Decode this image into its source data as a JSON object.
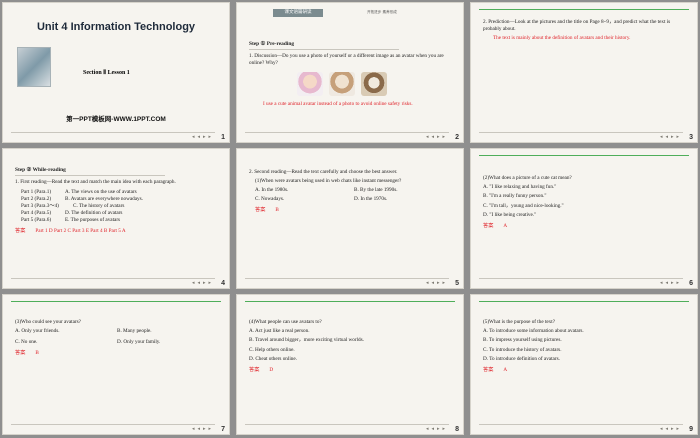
{
  "slides": [
    {
      "num": "1",
      "unit_title": "Unit 4   Information Technology",
      "section": "Section Ⅱ     Lesson 1",
      "brand": "第一PPT模板网-WWW.1PPT.COM"
    },
    {
      "num": "2",
      "header_tag": "课文语篇研读",
      "header_right": "开拓进步    素养形成",
      "step": "Step ①     Pre-reading",
      "question": "1.  Discussion—Do you use a photo of yourself or a different image as an avatar when you are online? Why?",
      "answer": "I use a cute animal avatar instead of a photo to avoid online safety risks."
    },
    {
      "num": "3",
      "prediction": "2.  Prediction—Look at the pictures and the title on Page 8~9，and predict what the text is probably about.",
      "answer": "The text is mainly about the definition of avatars and their history."
    },
    {
      "num": "4",
      "step": "Step ②     While-reading",
      "first": "1.  First reading—Read the text and match the main idea with each paragraph.",
      "pairs": [
        {
          "p": "Part 1 (Para.1)",
          "idea": "A.  The views on the use of avatars"
        },
        {
          "p": "Part 2 (Para.2)",
          "idea": "B.  Avatars are everywhere nowadays."
        },
        {
          "p": "Part 3 (Para.3～4)",
          "idea": "C.  The history of avatars"
        },
        {
          "p": "Part 4 (Para.5)",
          "idea": "D.  The definition of avatars"
        },
        {
          "p": "Part 5 (Para.6)",
          "idea": "E.  The purposes of avatars"
        }
      ],
      "answer_label": "答案",
      "answer": "Part 1 D   Part 2 C   Part 3 E   Part 4 B   Part 5 A"
    },
    {
      "num": "5",
      "second": "2.  Second reading—Read the text carefully and choose the best answer.",
      "q": "(1)When were avatars being used in web chats like instant messenger?",
      "opts": [
        "A.  In the 1980s.",
        "B.  By the late 1990s.",
        "C.  Nowadays.",
        "D.  In the 1970s."
      ],
      "answer_label": "答案",
      "answer": "B"
    },
    {
      "num": "6",
      "q": "(2)What does a picture of a cute cat mean?",
      "opts": [
        "A.  \"I like relaxing and having fun.\"",
        "B.  \"I'm a really funny person.\"",
        "C.  \"I'm tall，young and nice-looking.\"",
        "D.  \"I like being creative.\""
      ],
      "answer_label": "答案",
      "answer": "A"
    },
    {
      "num": "7",
      "q": "(3)Who could see your avatars?",
      "opts": [
        "A.  Only your friends.",
        "B.  Many people.",
        "C.  No one.",
        "D.  Only your family."
      ],
      "answer_label": "答案",
      "answer": "B"
    },
    {
      "num": "8",
      "q": "(4)What people can use avatars to?",
      "opts": [
        "A.  Act just like a real person.",
        "B.  Travel around bigger，more exciting virtual worlds.",
        "C.  Help others online.",
        "D.  Cheat others online."
      ],
      "answer_label": "答案",
      "answer": "D"
    },
    {
      "num": "9",
      "q": "(5)What is the purpose of the text?",
      "opts": [
        "A.  To introduce some information about avatars.",
        "B.  To impress yourself using pictures.",
        "C.  To introduce the history of avatars.",
        "D.  To introduce definition of avatars."
      ],
      "answer_label": "答案",
      "answer": "A"
    }
  ],
  "nav_glyphs": [
    "◂",
    "◂",
    "▸",
    "▸"
  ]
}
